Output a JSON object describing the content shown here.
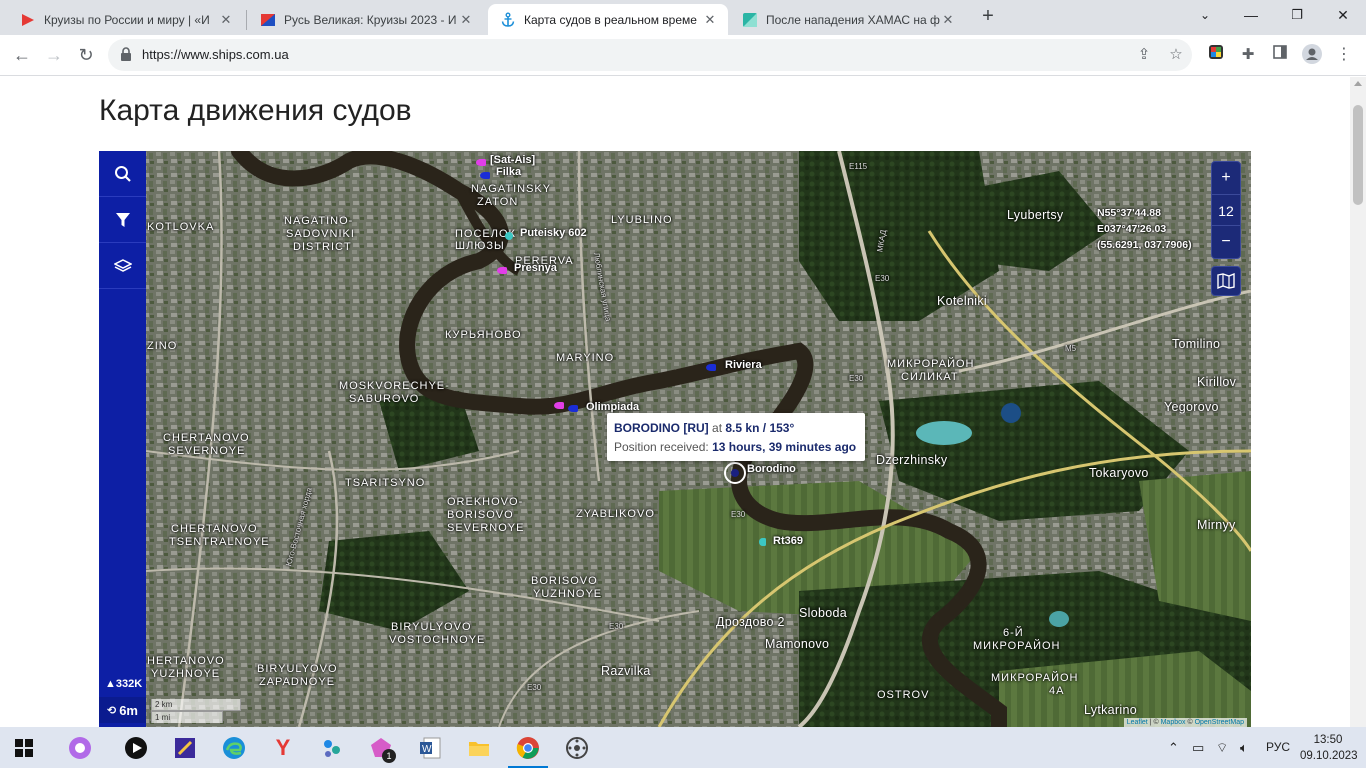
{
  "browser": {
    "tabs": [
      {
        "title": "Круизы по России и миру | «И",
        "favicon": "red-play-icon"
      },
      {
        "title": "Русь Великая: Круизы 2023 - И",
        "favicon": "flag-icon"
      },
      {
        "title": "Карта судов в реальном време",
        "favicon": "anchor-icon"
      },
      {
        "title": "После нападения ХАМАС на ф",
        "favicon": "teal-square-icon"
      }
    ],
    "url": "https://www.ships.com.ua"
  },
  "page": {
    "title": "Карта движения судов"
  },
  "map": {
    "sidebar": {
      "count_label": "332K",
      "time_label": "6m"
    },
    "zoom": {
      "plus": "+",
      "level": "12",
      "minus": "−"
    },
    "coordinates": {
      "lat": "N55°37'44.88",
      "lon": "E037°47'26.03",
      "decimal": "(55.6291, 037.7906)"
    },
    "popup": {
      "name": "BORODINO [RU]",
      "at": "at",
      "speed": "8.5 kn",
      "sep": "/",
      "course": "153°",
      "received_label": "Position received:",
      "received_value": "13 hours, 39 minutes ago"
    },
    "ships": [
      {
        "name": "[Sat-Ais]"
      },
      {
        "name": "Filka"
      },
      {
        "name": "Puteisky 602"
      },
      {
        "name": "Presnya"
      },
      {
        "name": "Riviera"
      },
      {
        "name": "Olimpiada"
      },
      {
        "name": "Borodino"
      },
      {
        "name": "Rt369"
      }
    ],
    "districts": [
      "NAGATINSKY",
      "ZATON",
      "NAGATINO-",
      "SADOVNIKI",
      "DISTRICT",
      "KOTLOVKA",
      "ПОСЕЛОК",
      "ШЛЮЗЫ",
      "PERERVA",
      "LYUBLINO",
      "КУРЬЯНОВО",
      "MARYINO",
      "MOSKVORECHYE-",
      "SABUROVO",
      "CHERTANOVO",
      "SEVERNOYE",
      "TSARITSYNO",
      "OREKHOVO-",
      "BORISOVO",
      "SEVERNOYE",
      "ZYABLIKOVO",
      "CHERTANOVO",
      "TSENTRALNOYE",
      "BORISOVO",
      "YUZHNOYE",
      "BIRYULYOVO",
      "VOSTOCHNOYE",
      "HERTANOVO",
      "YUZHNOYE",
      "BIRYULYOVO",
      "ZAPADNOYE",
      "OSTROV",
      "МИКРОРАЙОН",
      "СИЛИКАТ",
      "МИКРОРАЙОН",
      "4А",
      "6-Й",
      "МИКРОРАЙОН",
      "ZINO"
    ],
    "cities": [
      "Lyubertsy",
      "Kotelniki",
      "Tomilino",
      "Kirillov",
      "Yegorovo",
      "Dzerzhinsky",
      "Tokaryovo",
      "Mirnyy",
      "Sloboda",
      "Дроздово 2",
      "Mamonovo",
      "Razvilka",
      "Lytkarino"
    ],
    "roads": [
      "E115",
      "МКАД",
      "E30",
      "E30",
      "E30",
      "E30",
      "E30",
      "M5",
      "Люблинская улица",
      "Юго-Восточная хорда"
    ],
    "scale": {
      "km": "2 km",
      "mi": "1 mi"
    },
    "attribution": {
      "leaflet": "Leaflet",
      "sep1": "| ©",
      "mapbox": "Mapbox",
      "sep2": "©",
      "osm": "OpenStreetMap"
    }
  },
  "taskbar": {
    "lang": "РУС",
    "time": "13:50",
    "date": "09.10.2023",
    "badge": "1"
  }
}
